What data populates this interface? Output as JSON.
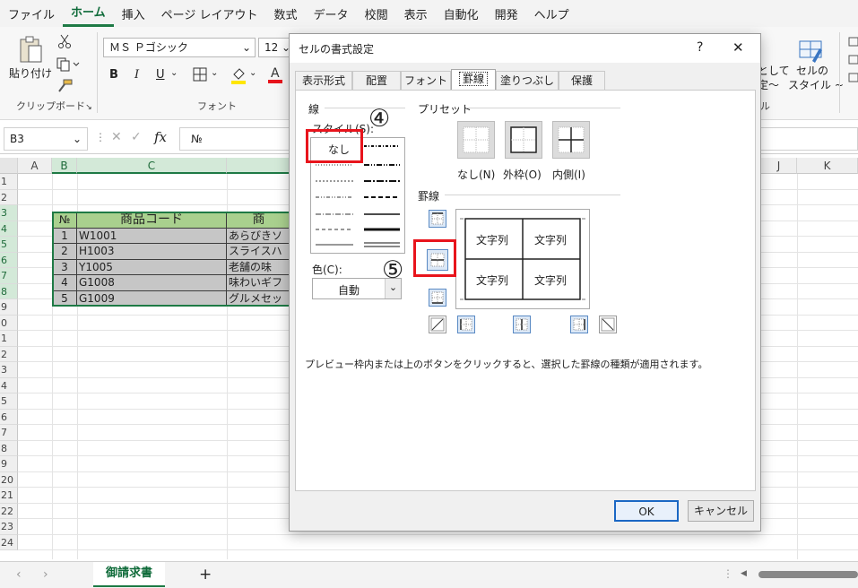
{
  "menu": [
    "ファイル",
    "ホーム",
    "挿入",
    "ページ レイアウト",
    "数式",
    "データ",
    "校閲",
    "表示",
    "自動化",
    "開発",
    "ヘルプ"
  ],
  "ribbon": {
    "paste_label": "貼り付け",
    "clipboard_group": "クリップボード",
    "font_name": "ＭＳ Ｐゴシック",
    "font_size": "12",
    "bold": "B",
    "italic": "I",
    "underline": "U",
    "font_group": "フォント",
    "cond_label_line1": "として",
    "cond_label_line2": "定～",
    "cell_style_line1": "セルの",
    "cell_style_line2": "スタイル ~",
    "style_group_tail": "ル"
  },
  "formula_bar": {
    "name_box": "B3",
    "fx": "fx",
    "content": "№"
  },
  "sheet": {
    "columns": [
      "A",
      "B",
      "C",
      "",
      "J",
      "K"
    ],
    "rows": [
      "1",
      "2",
      "3",
      "4",
      "5",
      "6",
      "7",
      "8",
      "9",
      "0",
      "1",
      "2",
      "3",
      "4",
      "5",
      "6",
      "7",
      "8",
      "9",
      "20",
      "21",
      "22",
      "23",
      "24"
    ],
    "table_header": [
      "№",
      "商品コード",
      "商"
    ],
    "table_rows": [
      [
        "1",
        "W1001",
        "あらびきソ"
      ],
      [
        "2",
        "H1003",
        "スライスハ"
      ],
      [
        "3",
        "Y1005",
        "老舗の味"
      ],
      [
        "4",
        "G1008",
        "味わいギフ"
      ],
      [
        "5",
        "G1009",
        "グルメセッ"
      ]
    ]
  },
  "sheet_tab": "御請求書",
  "colors": {
    "accent": "#1e7a45",
    "header_fill": "#a9d08e",
    "data_fill": "#c6c6c6",
    "red": "#e8141c",
    "button_blue": "#1a67c4"
  },
  "dialog": {
    "title": "セルの書式設定",
    "help": "?",
    "close": "✕",
    "tabs": [
      "表示形式",
      "配置",
      "フォント",
      "罫線",
      "塗りつぶし",
      "保護"
    ],
    "active_tab": "罫線",
    "line_group": "線",
    "style_label": "スタイル(S):",
    "none_style": "なし",
    "color_label": "色(C):",
    "color_value": "自動",
    "preset_group": "プリセット",
    "presets": [
      "なし(N)",
      "外枠(O)",
      "内側(I)"
    ],
    "border_group": "罫線",
    "preview_text": [
      "文字列",
      "文字列",
      "文字列",
      "文字列"
    ],
    "hint": "プレビュー枠内または上のボタンをクリックすると、選択した罫線の種類が適用されます。",
    "ok": "OK",
    "cancel": "キャンセル",
    "marker4": "④",
    "marker5": "⑤"
  }
}
